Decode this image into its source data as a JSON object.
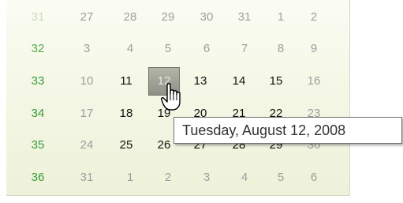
{
  "calendar": {
    "rows": [
      {
        "week": "31",
        "days": [
          "27",
          "28",
          "29",
          "30",
          "31",
          "1",
          "2"
        ]
      },
      {
        "week": "32",
        "days": [
          "3",
          "4",
          "5",
          "6",
          "7",
          "8",
          "9"
        ]
      },
      {
        "week": "33",
        "days": [
          "10",
          "11",
          "12",
          "13",
          "14",
          "15",
          "16"
        ]
      },
      {
        "week": "34",
        "days": [
          "17",
          "18",
          "19",
          "20",
          "21",
          "22",
          "23"
        ]
      },
      {
        "week": "35",
        "days": [
          "24",
          "25",
          "26",
          "27",
          "28",
          "29",
          "30"
        ]
      },
      {
        "week": "36",
        "days": [
          "31",
          "1",
          "2",
          "3",
          "4",
          "5",
          "6"
        ]
      }
    ],
    "selected_day": "12"
  },
  "tooltip": {
    "text": "Tuesday, August 12, 2008"
  },
  "cursor": {
    "icon": "hand-pointer-icon"
  },
  "colors": {
    "week_number": "#3a9a3a",
    "selected_bg": "#999b8f",
    "panel_bg": "#f3f6e3"
  }
}
